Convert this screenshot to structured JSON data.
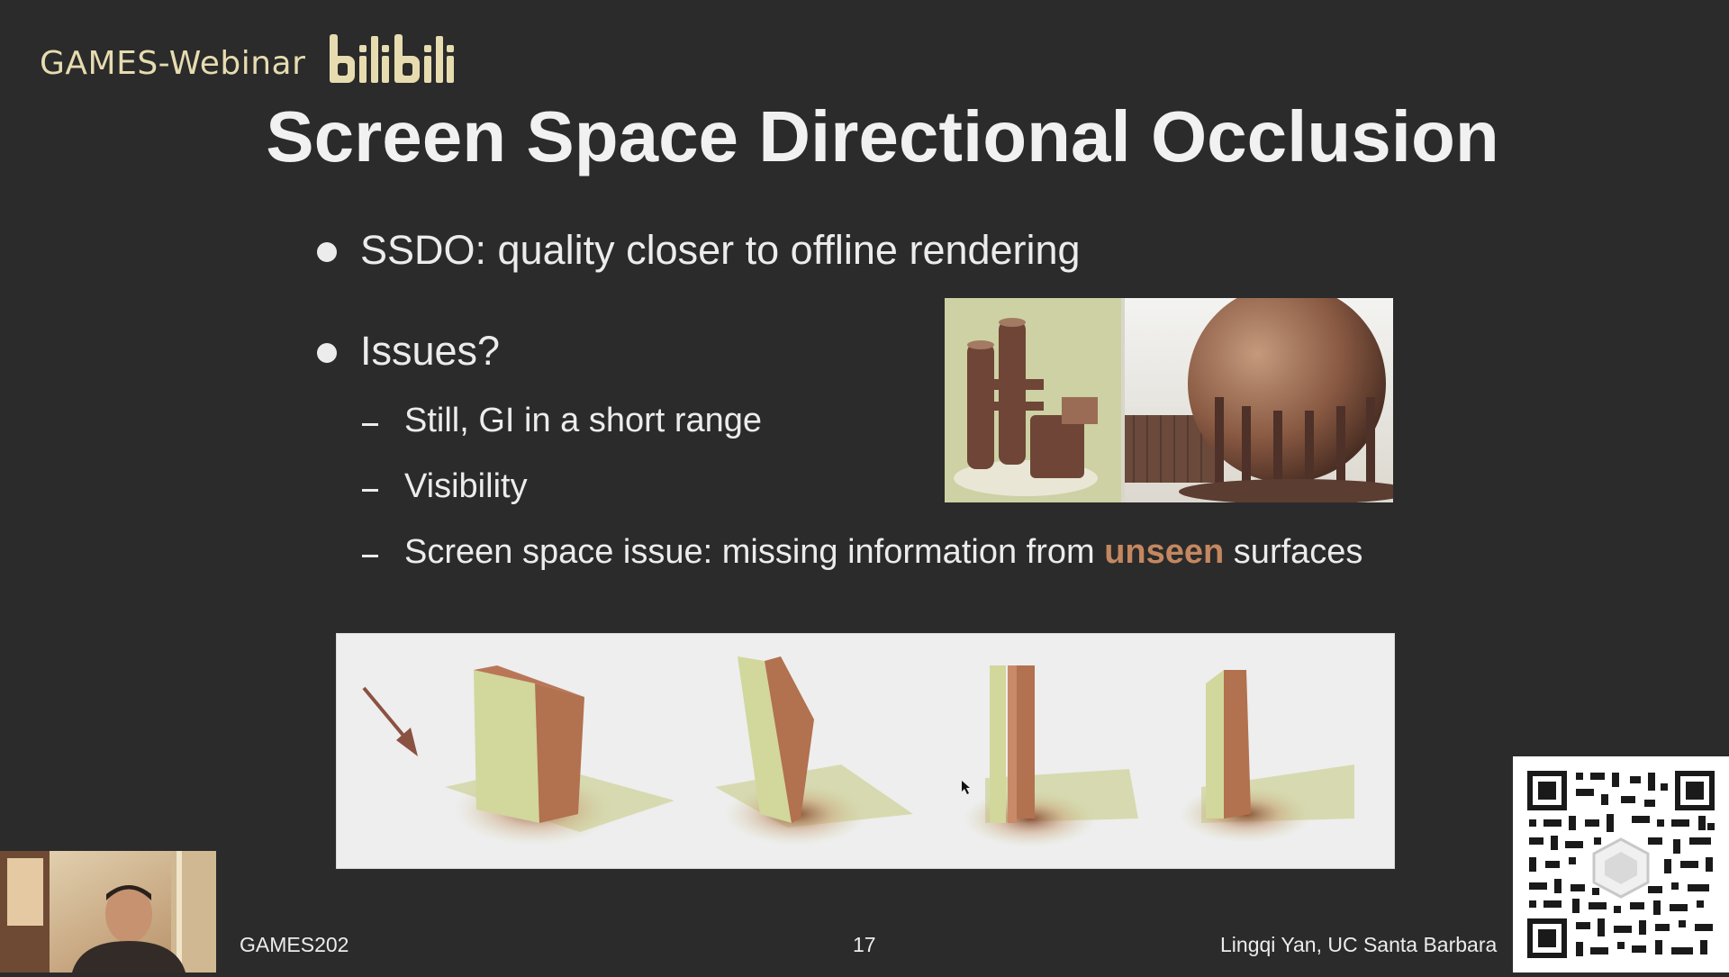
{
  "watermark": {
    "brand": "GAMES-Webinar",
    "logo_text": "bilibili",
    "logo_color": "#e6dcb0"
  },
  "slide": {
    "title": "Screen Space Directional Occlusion",
    "bullets": [
      {
        "text": "SSDO: quality closer to offline rendering"
      },
      {
        "text": "Issues?"
      }
    ],
    "sub_bullets": [
      {
        "text": "Still, GI in a short range"
      },
      {
        "text": "Visibility"
      },
      {
        "prefix": "Screen space issue: missing information from ",
        "highlight": "unseen",
        "suffix": " surfaces"
      }
    ],
    "highlight_color": "#c48760",
    "images": {
      "top": "ssdo-render-examples",
      "bottom": "occlusion-wall-comparison"
    }
  },
  "footer": {
    "left": "GAMES202",
    "page": "17",
    "right": "Lingqi Yan, UC Santa Barbara"
  },
  "overlays": {
    "webcam": "presenter-webcam",
    "qr": "qr-code"
  }
}
